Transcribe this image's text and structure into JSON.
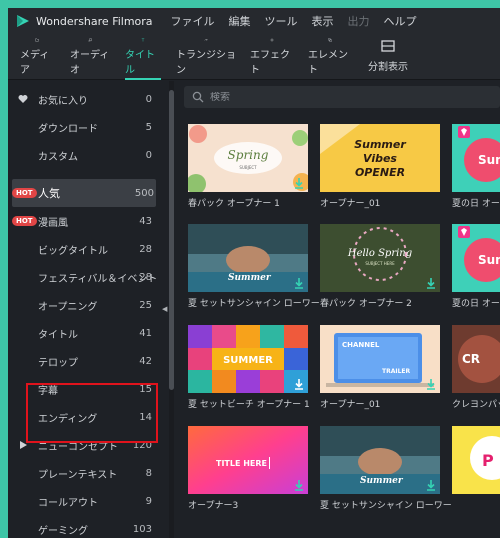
{
  "app": {
    "title": "Wondershare Filmora",
    "menu": [
      "ファイル",
      "編集",
      "ツール",
      "表示",
      "出力",
      "ヘルプ"
    ]
  },
  "toolbar": [
    {
      "label": "メディア",
      "icon": "folder-icon"
    },
    {
      "label": "オーディオ",
      "icon": "music-note-icon"
    },
    {
      "label": "タイトル",
      "icon": "text-t-icon",
      "active": true
    },
    {
      "label": "トランジション",
      "icon": "transition-icon"
    },
    {
      "label": "エフェクト",
      "icon": "effect-sparkle-icon"
    },
    {
      "label": "エレメント",
      "icon": "element-icon"
    },
    {
      "label": "分割表示",
      "icon": "split-screen-icon"
    }
  ],
  "sidebar": {
    "items": [
      {
        "label": "お気に入り",
        "count": "0",
        "icon": "heart-icon"
      },
      {
        "label": "ダウンロード",
        "count": "5"
      },
      {
        "label": "カスタム",
        "count": "0"
      },
      {
        "label": "人気",
        "count": "500",
        "badge": "HOT",
        "selected": true
      },
      {
        "label": "漫画風",
        "count": "43",
        "badge": "HOT"
      },
      {
        "label": "ビッグタイトル",
        "count": "28"
      },
      {
        "label": "フェスティバル＆イベント",
        "count": "28"
      },
      {
        "label": "オープニング",
        "count": "25"
      },
      {
        "label": "タイトル",
        "count": "41"
      },
      {
        "label": "テロップ",
        "count": "42"
      },
      {
        "label": "字幕",
        "count": "15"
      },
      {
        "label": "エンディング",
        "count": "14"
      },
      {
        "label": "ニューコンセプト",
        "count": "120",
        "expand": true
      },
      {
        "label": "プレーンテキスト",
        "count": "8"
      },
      {
        "label": "コールアウト",
        "count": "9"
      },
      {
        "label": "ゲーミング",
        "count": "103"
      }
    ]
  },
  "search": {
    "placeholder": "検索"
  },
  "cards": [
    {
      "label": "春パック オープナー 1",
      "thumb_text": "Spring",
      "thumb_sub": "SUBJECT"
    },
    {
      "label": "オープナー_01",
      "thumb_text": "Summer Vibes OPENER"
    },
    {
      "label": "夏の日 オープナー",
      "thumb_text": "Sum"
    },
    {
      "label": "夏 セットサンシャイン ローワーサ...",
      "thumb_text": "Summer"
    },
    {
      "label": "春パック オープナー 2",
      "thumb_text": "Hello Spring",
      "thumb_sub": "SUBJECT HERE"
    },
    {
      "label": "夏の日 オープナー",
      "thumb_text": "Sum"
    },
    {
      "label": "夏 セットビーチ オープナー 1",
      "thumb_text": "SUMMER"
    },
    {
      "label": "オープナー_01",
      "thumb_text": "CHANNEL",
      "thumb_sub": "TRAILER"
    },
    {
      "label": "クレヨンパック",
      "thumb_text": "CR"
    },
    {
      "label": "オープナー3",
      "thumb_text": "TITLE HERE"
    },
    {
      "label": "夏 セットサンシャイン ローワーサ...",
      "thumb_text": "Summer"
    },
    {
      "label": "",
      "thumb_text": "P"
    }
  ],
  "colors": {
    "accent": "#35d3b4",
    "hot_badge": "#e14646",
    "highlight_box": "#e0131c",
    "background": "#1e2126"
  }
}
